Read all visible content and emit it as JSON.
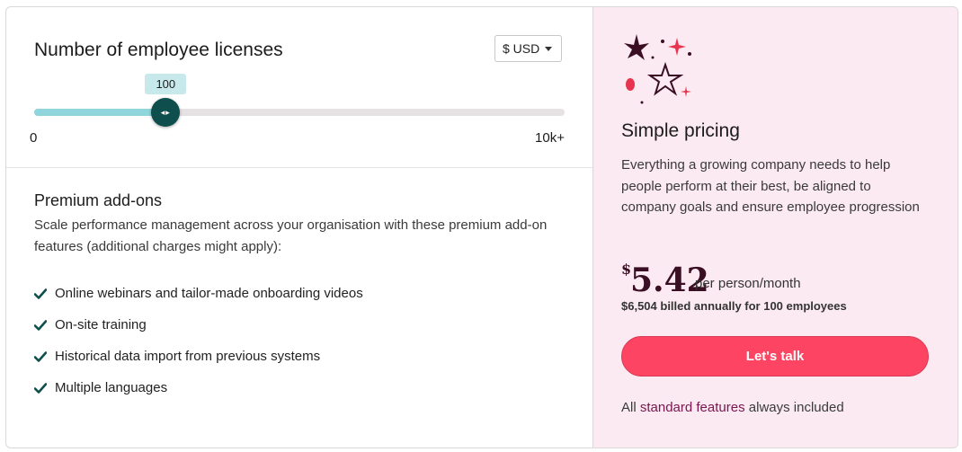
{
  "licenses": {
    "title": "Number of employee licenses",
    "currency": "$ USD",
    "slider": {
      "value_label": "100",
      "min_label": "0",
      "max_label": "10k+",
      "fill_fraction": 0.248
    }
  },
  "addons": {
    "title": "Premium add-ons",
    "description": "Scale performance management across your organisation with these premium add-on features (additional charges might apply):",
    "features": [
      "Online webinars and tailor-made onboarding videos",
      "On-site training",
      "Historical data import from previous systems",
      "Multiple languages"
    ]
  },
  "pricing": {
    "title": "Simple pricing",
    "description": "Everything a growing company needs to help people perform at their best, be aligned to company goals and ensure employee progression",
    "currency_symbol": "$",
    "amount": "5.42",
    "per": "per person/month",
    "billed": "$6,504 billed annually for 100 employees",
    "cta": "Let's talk",
    "included_prefix": "All",
    "included_link": "standard features",
    "included_suffix": "always included"
  },
  "colors": {
    "accent_pink": "#fd4462",
    "slider_fill": "#8ed6dc",
    "thumb": "#0e4e4c",
    "panel_bg": "#fbeaf1",
    "link": "#7a1550"
  }
}
